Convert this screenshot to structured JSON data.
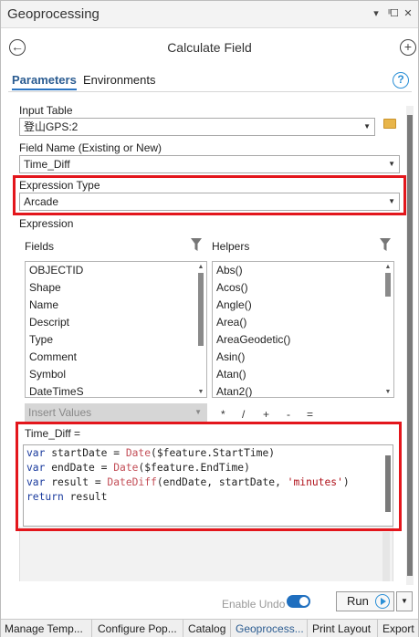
{
  "window": {
    "title": "Geoprocessing",
    "controls": [
      "▾",
      "ᴵᴵ",
      "☐",
      "✕"
    ]
  },
  "header": {
    "title": "Calculate Field",
    "back_icon": "back-arrow-icon",
    "add_icon": "add-icon"
  },
  "tabs": [
    {
      "label": "Parameters",
      "active": true
    },
    {
      "label": "Environments",
      "active": false
    }
  ],
  "params": {
    "input_table_label": "Input Table",
    "input_table_value": "登山GPS:2",
    "field_name_label": "Field Name (Existing or New)",
    "field_name_value": "Time_Diff",
    "expression_type_label": "Expression Type",
    "expression_type_value": "Arcade",
    "expression_label": "Expression",
    "fields_label": "Fields",
    "helpers_label": "Helpers",
    "fields": [
      "OBJECTID",
      "Shape",
      "Name",
      "Descript",
      "Type",
      "Comment",
      "Symbol",
      "DateTimeS"
    ],
    "helpers": [
      "Abs()",
      "Acos()",
      "Angle()",
      "Area()",
      "AreaGeodetic()",
      "Asin()",
      "Atan()",
      "Atan2()"
    ],
    "insert_values": "Insert Values",
    "operators": [
      "*",
      "/",
      "+",
      "-",
      "="
    ],
    "expression_target": "Time_Diff ="
  },
  "code": {
    "line1": {
      "kw": "var",
      "a": " startDate = ",
      "fn": "Date",
      "b": "($feature.StartTime)"
    },
    "line2": {
      "kw": "var",
      "a": " endDate = ",
      "fn": "Date",
      "b": "($feature.EndTime)"
    },
    "line3": {
      "kw": "var",
      "a": " result = ",
      "fn": "DateDiff",
      "b": "(endDate, startDate, ",
      "str": "'minutes'",
      "c": ")"
    },
    "line4": {
      "kw": "return",
      "a": " result"
    }
  },
  "footer": {
    "enable_undo": "Enable Undo",
    "run": "Run"
  },
  "bottom_tabs": [
    {
      "label": "Manage Temp...",
      "active": false
    },
    {
      "label": "Configure Pop...",
      "active": false
    },
    {
      "label": "Catalog",
      "active": false
    },
    {
      "label": "Geoprocess...",
      "active": true
    },
    {
      "label": "Print Layout",
      "active": false
    },
    {
      "label": "Export",
      "active": false
    }
  ],
  "colors": {
    "highlight_border": "#e3161c",
    "accent": "#2b8fd6",
    "keyword": "#1a3b9e",
    "function": "#c34e57",
    "string": "#b0121b"
  }
}
